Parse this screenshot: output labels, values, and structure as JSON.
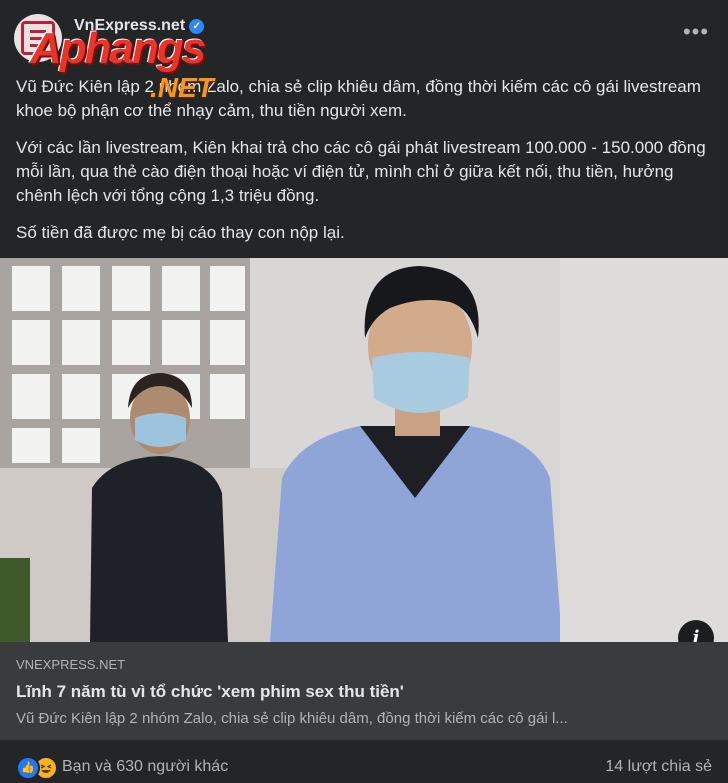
{
  "post": {
    "page_name": "VnExpress.net",
    "verified_glyph": "✓",
    "more_glyph": "•••",
    "watermark": {
      "main": "Aphangs",
      "sub": ".NET"
    },
    "paragraphs": [
      "Vũ Đức Kiên lập 2 nhóm Zalo, chia sẻ clip khiêu dâm, đồng thời kiếm các cô gái livestream khoe bộ phận cơ thể nhạy cảm, thu tiền người xem.",
      "Với các lần livestream, Kiên khai trả cho các cô gái phát livestream 100.000 - 150.000 đồng mỗi lần, qua thẻ cào điện thoại hoặc ví điện tử, mình chỉ ở giữa kết nối, thu tiền, hưởng chênh lệch với tổng cộng 1,3 triệu đồng.",
      "Số tiền đã được mẹ bị cáo thay con nộp lại."
    ]
  },
  "photo": {
    "info_glyph": "i"
  },
  "link": {
    "domain": "VNEXPRESS.NET",
    "title": "Lĩnh 7 năm tù vì tổ chức 'xem phim sex thu tiền'",
    "description": "Vũ Đức Kiên lập 2 nhóm Zalo, chia sẻ clip khiêu dâm, đồng thời kiếm các cô gái l..."
  },
  "footer": {
    "like_glyph": "👍",
    "reactions_text": "Bạn và 630 người khác",
    "shares_text": "14 lượt chia sẻ"
  },
  "colors": {
    "background": "#242526",
    "link_box": "#3a3b3c",
    "accent": "#2d88ff"
  }
}
